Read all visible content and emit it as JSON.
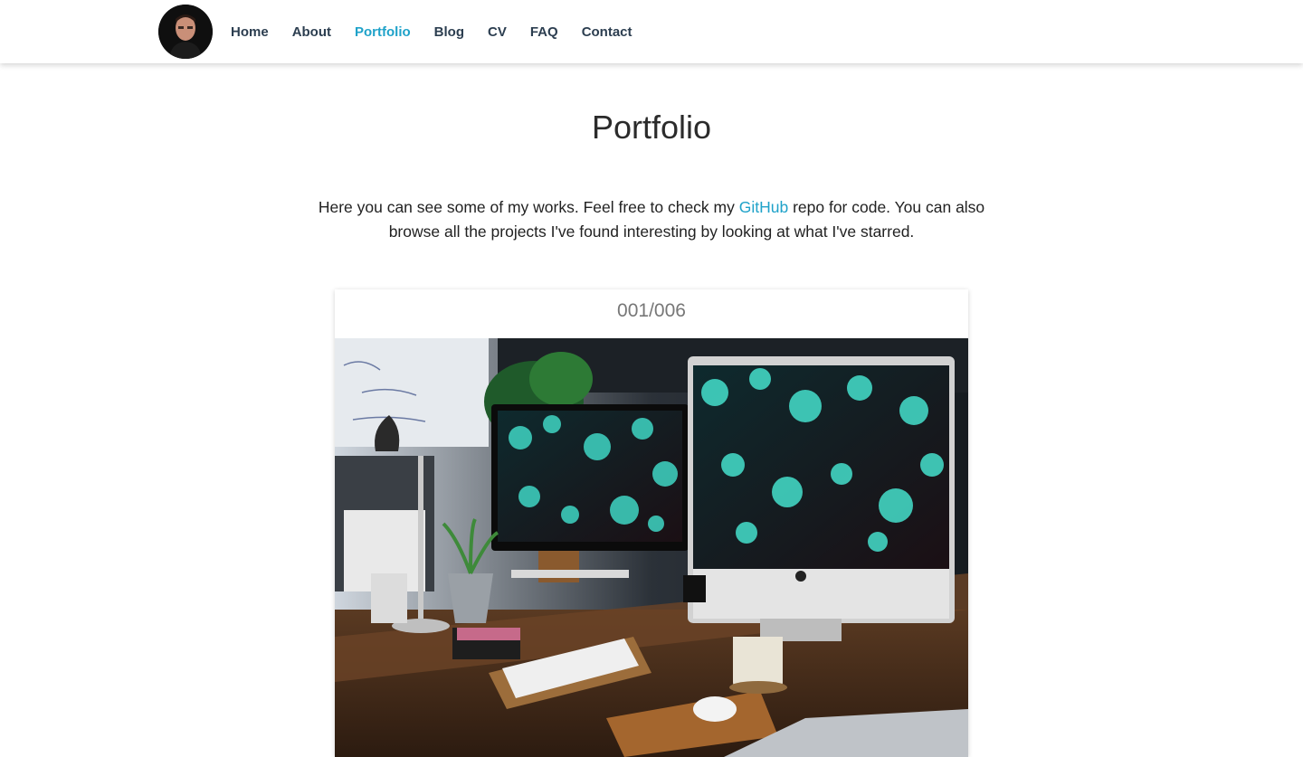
{
  "nav": {
    "items": [
      {
        "label": "Home",
        "active": false
      },
      {
        "label": "About",
        "active": false
      },
      {
        "label": "Portfolio",
        "active": true
      },
      {
        "label": "Blog",
        "active": false
      },
      {
        "label": "CV",
        "active": false
      },
      {
        "label": "FAQ",
        "active": false
      },
      {
        "label": "Contact",
        "active": false
      }
    ]
  },
  "page": {
    "title": "Portfolio",
    "intro_before": "Here you can see some of my works. Feel free to check my ",
    "intro_link": "GitHub",
    "intro_after": " repo for code. You can also browse all the projects I've found interesting by looking at what I've starred."
  },
  "portfolio": {
    "counter": "001/006"
  },
  "colors": {
    "accent": "#1fa2c9",
    "nav_text": "#2c3e50"
  }
}
